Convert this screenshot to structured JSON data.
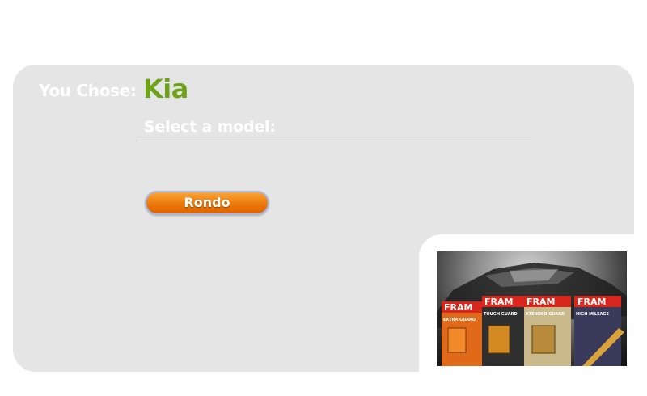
{
  "selection": {
    "you_chose_label": "You Chose:",
    "brand": "Kia"
  },
  "model_selector": {
    "prompt": "Select a model:",
    "models": [
      {
        "label": "Rondo"
      }
    ]
  },
  "promo": {
    "description": "FRAM oil filter product boxes in front of a car",
    "boxes": [
      {
        "brand": "FRAM",
        "line": "EXTRA GUARD",
        "color": "#e06a1a"
      },
      {
        "brand": "FRAM",
        "line": "TOUGH GUARD",
        "color": "#2f2f2f"
      },
      {
        "brand": "FRAM",
        "line": "XTENDED GUARD",
        "color": "#c9b98b"
      },
      {
        "brand": "FRAM",
        "line": "HIGH MILEAGE",
        "color": "#3a3a5a"
      }
    ]
  },
  "colors": {
    "panel_bg": "#e5e5e5",
    "brand_green": "#6ea21a",
    "button_orange": "#ee7d0c",
    "button_border": "#a7b9e3"
  }
}
